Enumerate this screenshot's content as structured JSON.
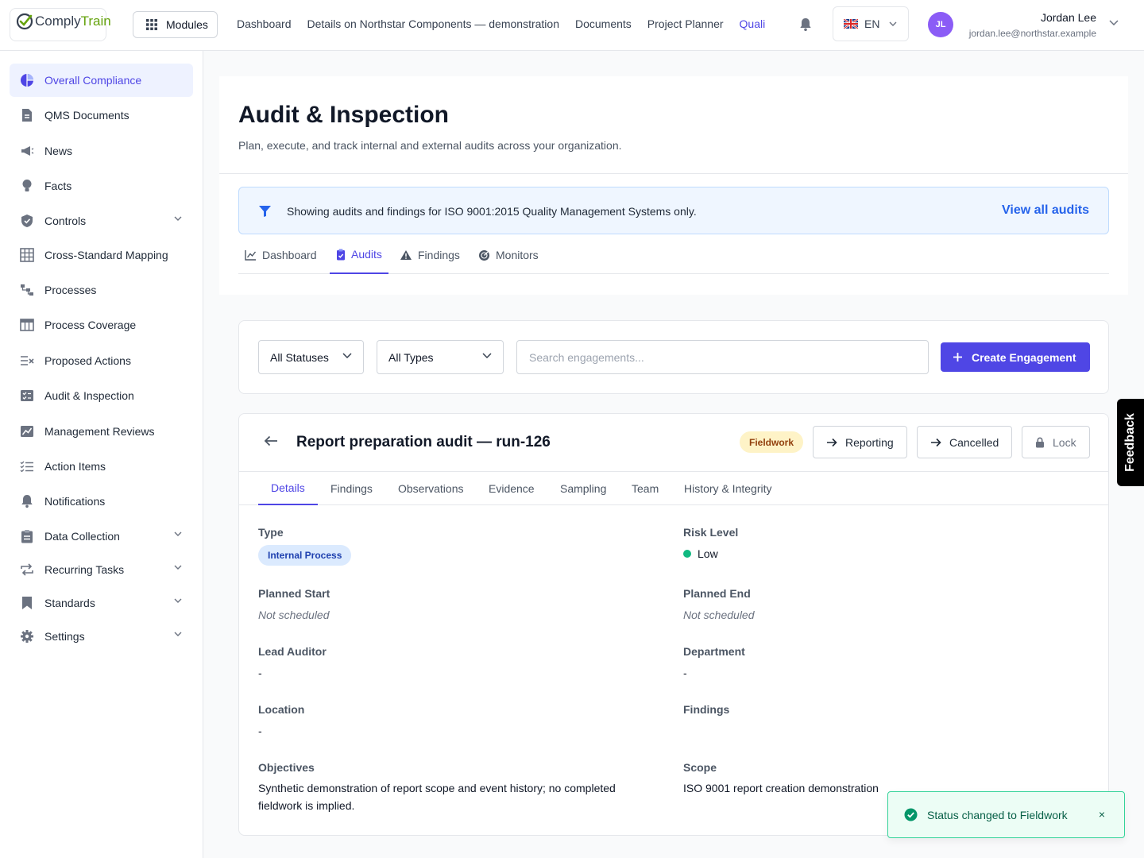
{
  "app": {
    "logo_part1": "Comply",
    "logo_part2": "Train",
    "brand_color": "#4f46e5"
  },
  "topbar": {
    "modules_label": "Modules",
    "nav": [
      "Dashboard",
      "Details on Northstar Components — demonstration",
      "Documents",
      "Project Planner",
      "Quali"
    ],
    "active_nav": "Quali",
    "language": "EN",
    "user": {
      "initials": "JL",
      "name": "Jordan Lee",
      "email": "jordan.lee@northstar.example"
    }
  },
  "sidebar": {
    "items": [
      {
        "label": "Overall Compliance",
        "icon": "pie-chart-icon",
        "active": true
      },
      {
        "label": "QMS Documents",
        "icon": "document-icon"
      },
      {
        "label": "News",
        "icon": "megaphone-icon"
      },
      {
        "label": "Facts",
        "icon": "lightbulb-icon"
      },
      {
        "label": "Controls",
        "icon": "shield-icon",
        "expandable": true
      },
      {
        "label": "Cross-Standard Mapping",
        "icon": "grid-icon"
      },
      {
        "label": "Processes",
        "icon": "process-flow-icon"
      },
      {
        "label": "Process Coverage",
        "icon": "table-icon"
      },
      {
        "label": "Proposed Actions",
        "icon": "list-x-icon"
      },
      {
        "label": "Audit & Inspection",
        "icon": "checklist-icon"
      },
      {
        "label": "Management Reviews",
        "icon": "chart-box-icon"
      },
      {
        "label": "Action Items",
        "icon": "list-check-icon"
      },
      {
        "label": "Notifications",
        "icon": "bell-icon"
      },
      {
        "label": "Data Collection",
        "icon": "clipboard-icon",
        "expandable": true
      },
      {
        "label": "Recurring Tasks",
        "icon": "repeat-icon",
        "expandable": true
      },
      {
        "label": "Standards",
        "icon": "bookmark-icon",
        "expandable": true
      },
      {
        "label": "Settings",
        "icon": "gear-icon",
        "expandable": true
      }
    ]
  },
  "page": {
    "title": "Audit & Inspection",
    "subtitle": "Plan, execute, and track internal and external audits across your organization.",
    "filter_banner": {
      "text": "Showing audits and findings for ISO 9001:2015 Quality Management Systems only.",
      "link": "View all audits"
    },
    "tabs": [
      {
        "label": "Dashboard",
        "icon": "line-chart-icon"
      },
      {
        "label": "Audits",
        "icon": "clipboard-check-icon",
        "active": true
      },
      {
        "label": "Findings",
        "icon": "warning-icon"
      },
      {
        "label": "Monitors",
        "icon": "radar-icon"
      }
    ]
  },
  "toolbar": {
    "status_filter": "All Statuses",
    "type_filter": "All Types",
    "search_placeholder": "Search engagements...",
    "create_label": "Create Engagement"
  },
  "engagement": {
    "title": "Report preparation audit — run-126",
    "status": "Fieldwork",
    "actions": {
      "reporting": "Reporting",
      "cancelled": "Cancelled",
      "lock": "Lock"
    },
    "tabs": [
      "Details",
      "Findings",
      "Observations",
      "Evidence",
      "Sampling",
      "Team",
      "History & Integrity"
    ],
    "active_tab": "Details",
    "fields": {
      "type_label": "Type",
      "type_value": "Internal Process",
      "risk_label": "Risk Level",
      "risk_value": "Low",
      "risk_color": "#10b981",
      "planned_start_label": "Planned Start",
      "planned_start_value": "Not scheduled",
      "planned_end_label": "Planned End",
      "planned_end_value": "Not scheduled",
      "lead_auditor_label": "Lead Auditor",
      "lead_auditor_value": "-",
      "department_label": "Department",
      "department_value": "-",
      "location_label": "Location",
      "location_value": "-",
      "findings_label": "Findings",
      "findings_value": "",
      "objectives_label": "Objectives",
      "objectives_value": "Synthetic demonstration of report scope and event history; no completed fieldwork is implied.",
      "scope_label": "Scope",
      "scope_value": "ISO 9001 report creation demonstration"
    }
  },
  "feedback_label": "Feedback",
  "toast": {
    "message": "Status changed to Fieldwork",
    "close": "×"
  }
}
